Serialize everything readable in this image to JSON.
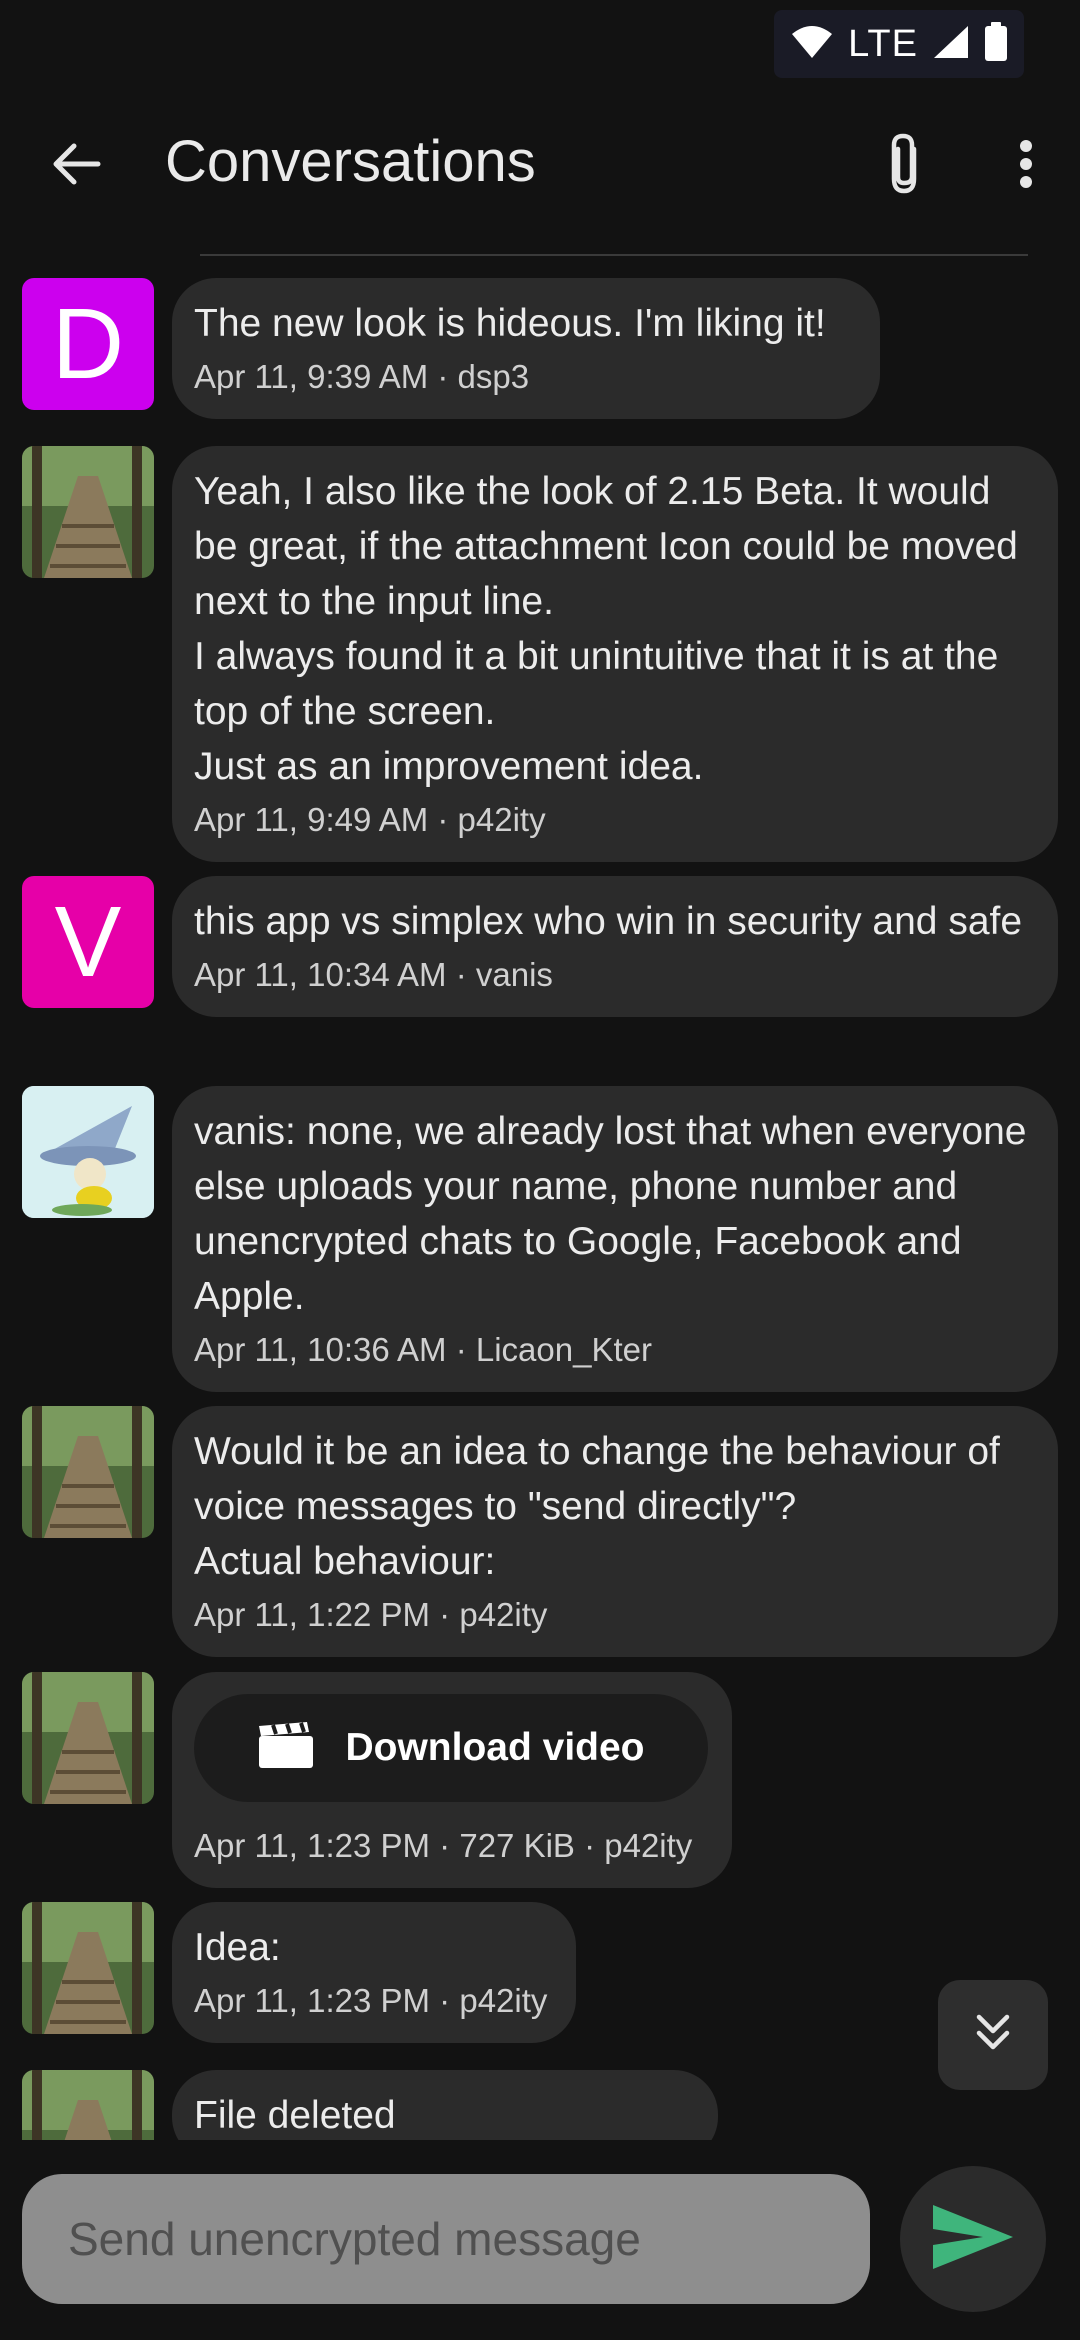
{
  "status_bar": {
    "network": "LTE"
  },
  "app_bar": {
    "title": "Conversations"
  },
  "messages": [
    {
      "avatar_letter": "D",
      "avatar_color": "#cc00ee",
      "text": "The new look is hideous. I'm liking it!",
      "meta": "Apr 11, 9:39 AM · dsp3"
    },
    {
      "avatar_image": "forest-boardwalk",
      "text": "Yeah, I also like the look of 2.15 Beta. It would be great, if the attachment Icon could be moved next to the input line.\nI always found it a bit unintuitive that it is at the top of the screen.\nJust as an improvement idea.",
      "meta": "Apr 11, 9:49 AM · p42ity"
    },
    {
      "avatar_letter": "V",
      "avatar_color": "#e600a8",
      "text": "this app vs simplex who win in security and safe",
      "meta": "Apr 11, 10:34 AM · vanis"
    },
    {
      "avatar_image": "wizard-cartoon",
      "text": "vanis: none, we already lost that when everyone else uploads your name, phone number and unencrypted chats to Google, Facebook and Apple.",
      "meta": "Apr 11, 10:36 AM · Licaon_Kter"
    },
    {
      "avatar_image": "forest-boardwalk",
      "text": "Would it be an idea to change the behaviour of voice messages to \"send directly\"?\nActual behaviour:",
      "meta": "Apr 11, 1:22 PM · p42ity"
    },
    {
      "avatar_image": "forest-boardwalk",
      "video_button_label": "Download video",
      "meta": "Apr 11, 1:23 PM · 727 KiB · p42ity"
    },
    {
      "avatar_image": "forest-boardwalk",
      "text": "Idea:",
      "meta": "Apr 11, 1:23 PM · p42ity"
    },
    {
      "avatar_image": "forest-boardwalk",
      "text": "File deleted"
    }
  ],
  "composer": {
    "placeholder": "Send unencrypted message"
  },
  "colors": {
    "background": "#121212",
    "bubble": "#2b2b2b",
    "send_accent": "#3fb57c"
  }
}
